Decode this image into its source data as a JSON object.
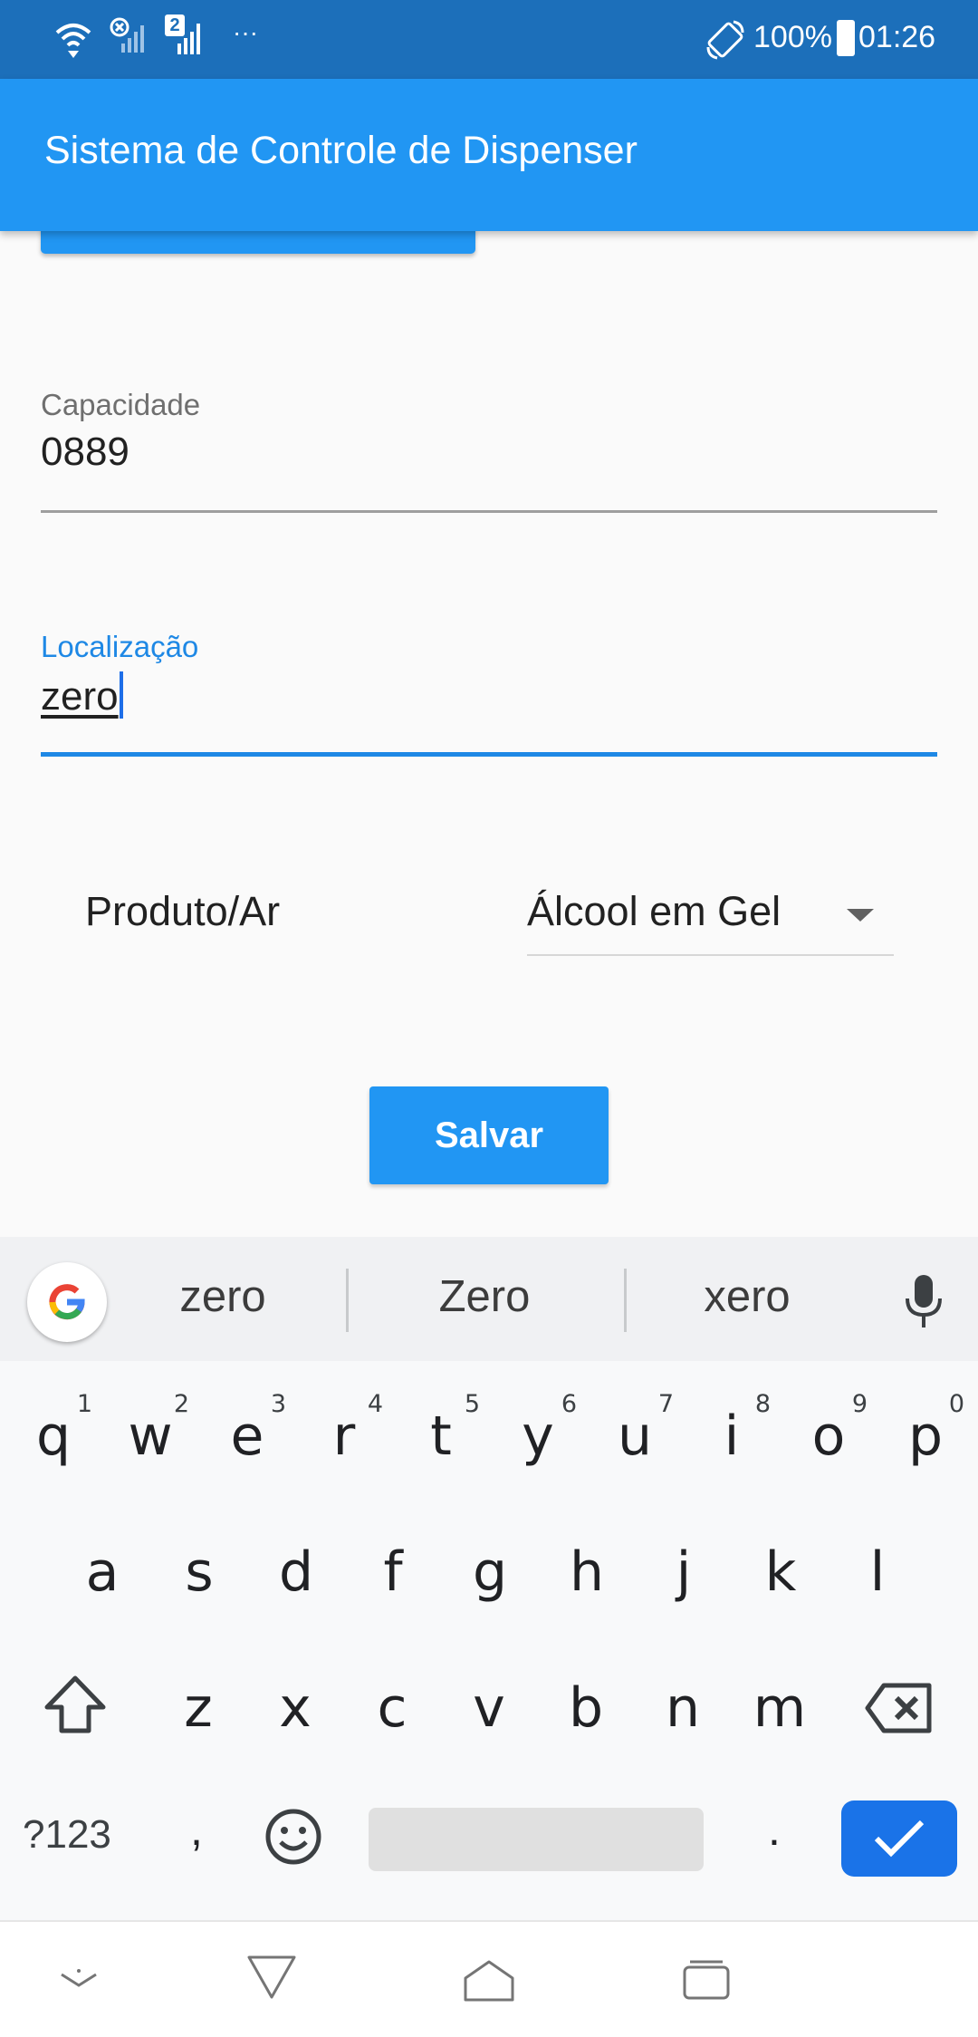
{
  "status_bar": {
    "battery_percent": "100%",
    "time": "01:26",
    "sim_badge": "2",
    "overflow": "···"
  },
  "app_bar": {
    "title": "Sistema de Controle de Dispenser"
  },
  "form": {
    "capacity": {
      "label": "Capacidade",
      "value": "0889"
    },
    "location": {
      "label": "Localização",
      "value": "zero"
    },
    "product": {
      "label": "Produto/Ar",
      "selected": "Álcool em Gel"
    },
    "save_label": "Salvar"
  },
  "keyboard": {
    "suggestions": [
      "zero",
      "Zero",
      "xero"
    ],
    "row1": [
      {
        "k": "q",
        "h": "1"
      },
      {
        "k": "w",
        "h": "2"
      },
      {
        "k": "e",
        "h": "3"
      },
      {
        "k": "r",
        "h": "4"
      },
      {
        "k": "t",
        "h": "5"
      },
      {
        "k": "y",
        "h": "6"
      },
      {
        "k": "u",
        "h": "7"
      },
      {
        "k": "i",
        "h": "8"
      },
      {
        "k": "o",
        "h": "9"
      },
      {
        "k": "p",
        "h": "0"
      }
    ],
    "row2": [
      "a",
      "s",
      "d",
      "f",
      "g",
      "h",
      "j",
      "k",
      "l"
    ],
    "row3": [
      "z",
      "x",
      "c",
      "v",
      "b",
      "n",
      "m"
    ],
    "symbols_label": "?123",
    "comma": ",",
    "period": ".",
    "icons": {
      "shift": "shift-icon",
      "backspace": "backspace-icon",
      "emoji": "emoji-icon",
      "done": "check-icon",
      "mic": "microphone-icon",
      "google": "google-logo-icon"
    },
    "accent_color": "#1a73e8"
  },
  "nav_bar": {
    "icons": [
      "hide-keyboard-icon",
      "back-icon",
      "home-icon",
      "recents-icon"
    ]
  },
  "colors": {
    "primary": "#2196f3",
    "status_bar": "#1c6fba",
    "focus": "#1e88e5"
  }
}
